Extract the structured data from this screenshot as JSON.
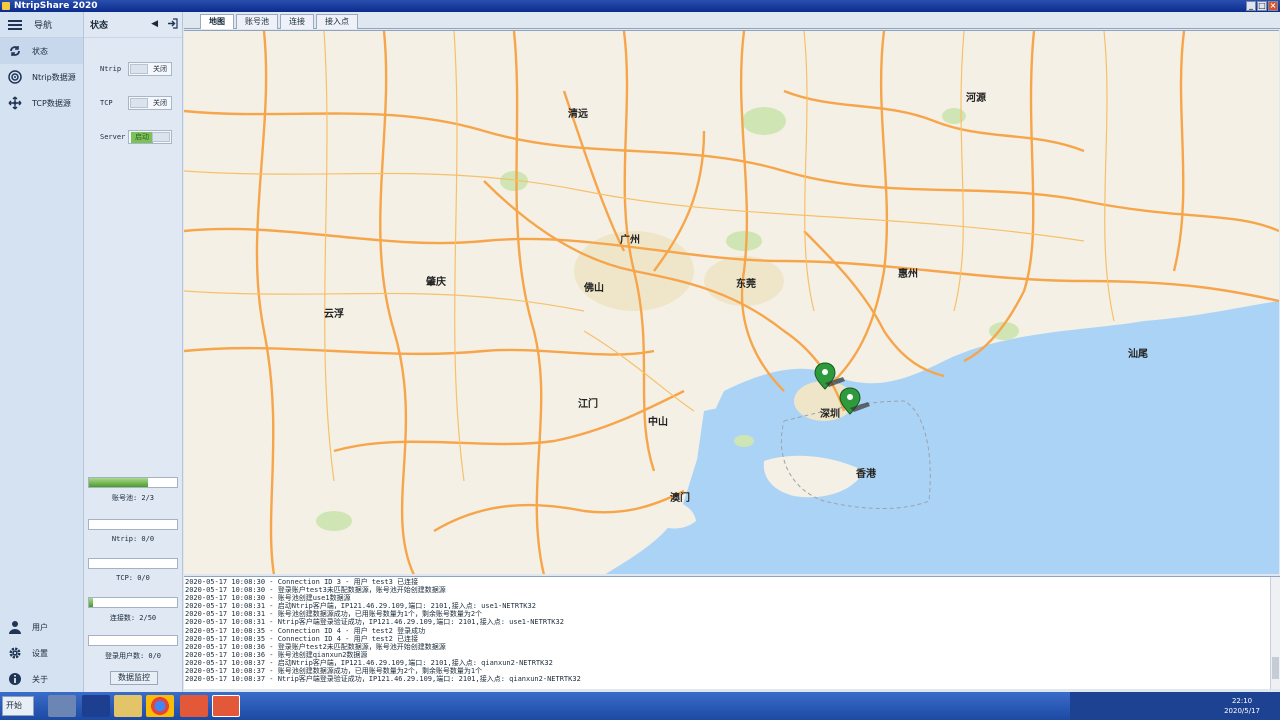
{
  "window": {
    "title": "NtripShare 2020",
    "buttons": [
      "_",
      "□",
      "×"
    ]
  },
  "nav": {
    "header": "导航",
    "items": [
      {
        "label": "状态",
        "icon": "refresh-icon"
      },
      {
        "label": "Ntrip数据源",
        "icon": "target-icon"
      },
      {
        "label": "TCP数据源",
        "icon": "move-icon"
      }
    ],
    "bottom_items": [
      {
        "label": "用户",
        "icon": "user-icon"
      },
      {
        "label": "设置",
        "icon": "gear-icon"
      },
      {
        "label": "关于",
        "icon": "info-icon"
      }
    ]
  },
  "status": {
    "title": "状态",
    "toggles": [
      {
        "label": "Ntrip",
        "value": "关闭",
        "on": false
      },
      {
        "label": "TCP",
        "value": "关闭",
        "on": false
      },
      {
        "label": "Server",
        "value": "启动",
        "on": true
      }
    ],
    "meters": [
      {
        "label": "账号池: 2/3",
        "fill": 0.67
      },
      {
        "label": "Ntrip: 0/0",
        "fill": 0
      },
      {
        "label": "TCP: 0/0",
        "fill": 0
      },
      {
        "label": "连接数: 2/50",
        "fill": 0.04
      },
      {
        "label": "登录用户数: 0/0",
        "fill": 0
      }
    ],
    "monitor_button": "数据监控"
  },
  "tabs": [
    "地图",
    "账号池",
    "连接",
    "接入点"
  ],
  "map": {
    "cities": [
      {
        "name": "清远"
      },
      {
        "name": "广州"
      },
      {
        "name": "佛山"
      },
      {
        "name": "肇庆"
      },
      {
        "name": "东莞"
      },
      {
        "name": "惠州"
      },
      {
        "name": "河源"
      },
      {
        "name": "云浮"
      },
      {
        "name": "江门"
      },
      {
        "name": "中山"
      },
      {
        "name": "深圳"
      },
      {
        "name": "香港"
      },
      {
        "name": "澳门"
      },
      {
        "name": "汕尾"
      }
    ],
    "colors": {
      "land": "#f4f0e5",
      "sea": "#abd3f5",
      "highway": "#f7a54a",
      "green": "#cfe5b4"
    }
  },
  "log": {
    "lines": [
      "2020-05-17 10:08:30 - Connection ID 3 - 用户 test3 已连接",
      "2020-05-17 10:08:30 - 登录账户test3未匹配数据源，账号池开始创建数据源",
      "2020-05-17 10:08:30 - 账号池创建use1数据源",
      "2020-05-17 10:08:31 - 启动Ntrip客户端，IP121.46.29.109,端口: 2101,接入点: use1-NETRTK32",
      "2020-05-17 10:08:31 - 账号池创建数据源成功，已用账号数量为1个，剩余账号数量为2个",
      "2020-05-17 10:08:31 - Ntrip客户端登录验证成功，IP121.46.29.109,端口: 2101,接入点: use1-NETRTK32",
      "2020-05-17 10:08:35 - Connection ID 4 - 用户 test2 登录成功",
      "2020-05-17 10:08:35 - Connection ID 4 - 用户 test2 已连接",
      "2020-05-17 10:08:36 - 登录账户test2未匹配数据源，账号池开始创建数据源",
      "2020-05-17 10:08:36 - 账号池创建qianxun2数据源",
      "2020-05-17 10:08:37 - 启动Ntrip客户端，IP121.46.29.109,端口: 2101,接入点: qianxun2-NETRTK32",
      "2020-05-17 10:08:37 - 账号池创建数据源成功，已用账号数量为2个，剩余账号数量为1个",
      "2020-05-17 10:08:37 - Ntrip客户端登录验证成功，IP121.46.29.109,端口: 2101,接入点: qianxun2-NETRTK32"
    ]
  },
  "taskbar": {
    "start": "开始",
    "time": "22:10",
    "date": "2020/5/17"
  }
}
